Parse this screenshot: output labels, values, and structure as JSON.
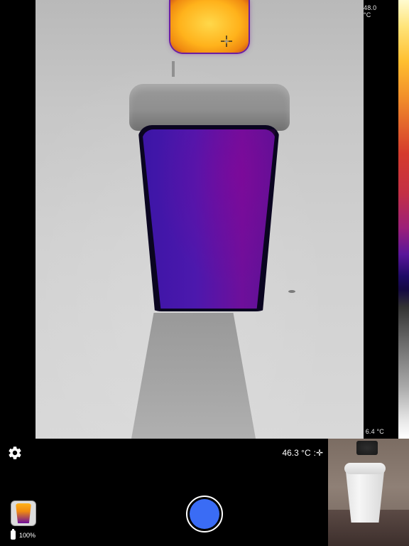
{
  "thermal_view": {
    "scale_max": "48.0 °C",
    "scale_min": "6.4 °C",
    "palette": "iron",
    "colors": {
      "hot": "#ffb21b",
      "cold": "#4c18ad",
      "background": "#c7c7c7"
    }
  },
  "toolbar": {
    "settings_icon": "gear-icon",
    "spot_readout": "46.3 °C",
    "spot_icon": "crosshair-icon",
    "battery_level": "100%",
    "capture_color": "#3a6cf5"
  },
  "camera_preview": {
    "subject": "white foam cup on table"
  }
}
